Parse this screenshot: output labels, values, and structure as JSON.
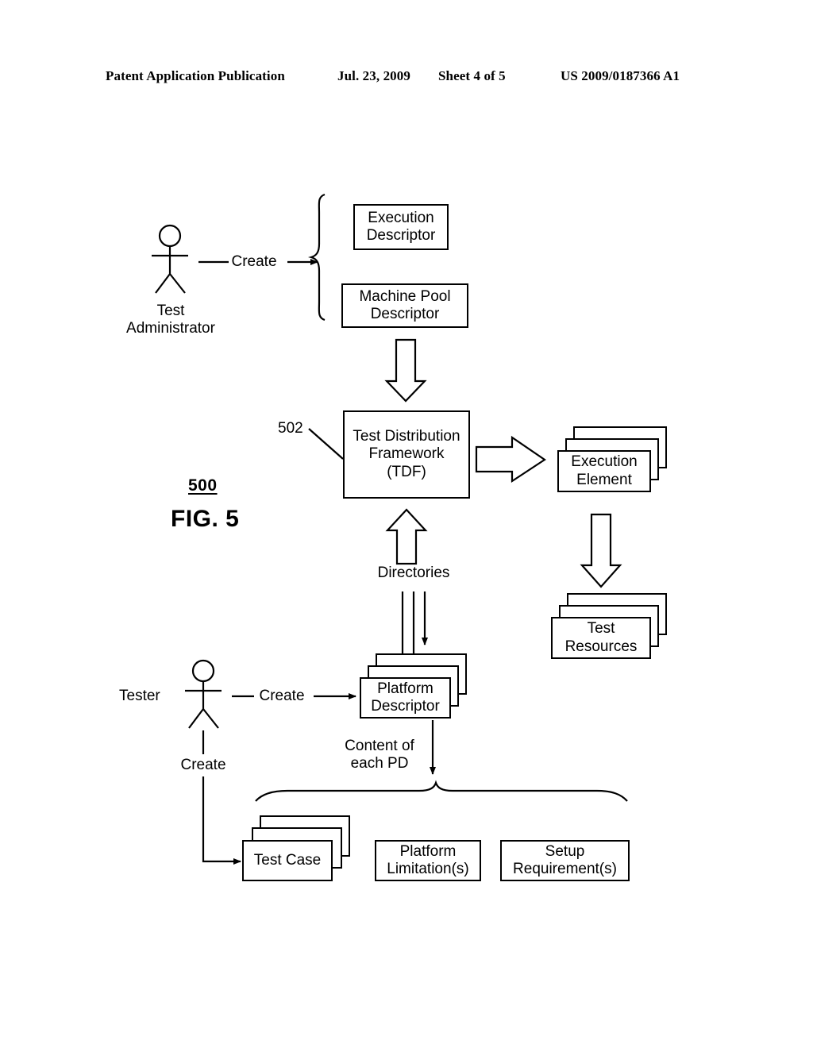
{
  "header": {
    "publication": "Patent Application Publication",
    "date": "Jul. 23, 2009",
    "sheet": "Sheet 4 of 5",
    "patent_number": "US 2009/0187366 A1"
  },
  "figure": {
    "reference_number": "500",
    "caption": "FIG. 5",
    "callout_502": "502"
  },
  "actors": {
    "test_administrator": "Test\nAdministrator",
    "tester": "Tester"
  },
  "edges": {
    "admin_create": "Create",
    "tester_create": "Create",
    "tester_create_down": "Create",
    "directories": "Directories",
    "content_of_each_pd": "Content of\neach PD"
  },
  "nodes": {
    "execution_descriptor": "Execution\nDescriptor",
    "machine_pool_descriptor": "Machine Pool\nDescriptor",
    "tdf": "Test Distribution\nFramework\n(TDF)",
    "execution_element": "Execution\nElement",
    "test_resources": "Test\nResources",
    "platform_descriptor": "Platform\nDescriptor",
    "test_case": "Test Case",
    "platform_limitations": "Platform\nLimitation(s)",
    "setup_requirements": "Setup\nRequirement(s)"
  },
  "colors": {
    "ink": "#000000",
    "paper": "#ffffff"
  }
}
